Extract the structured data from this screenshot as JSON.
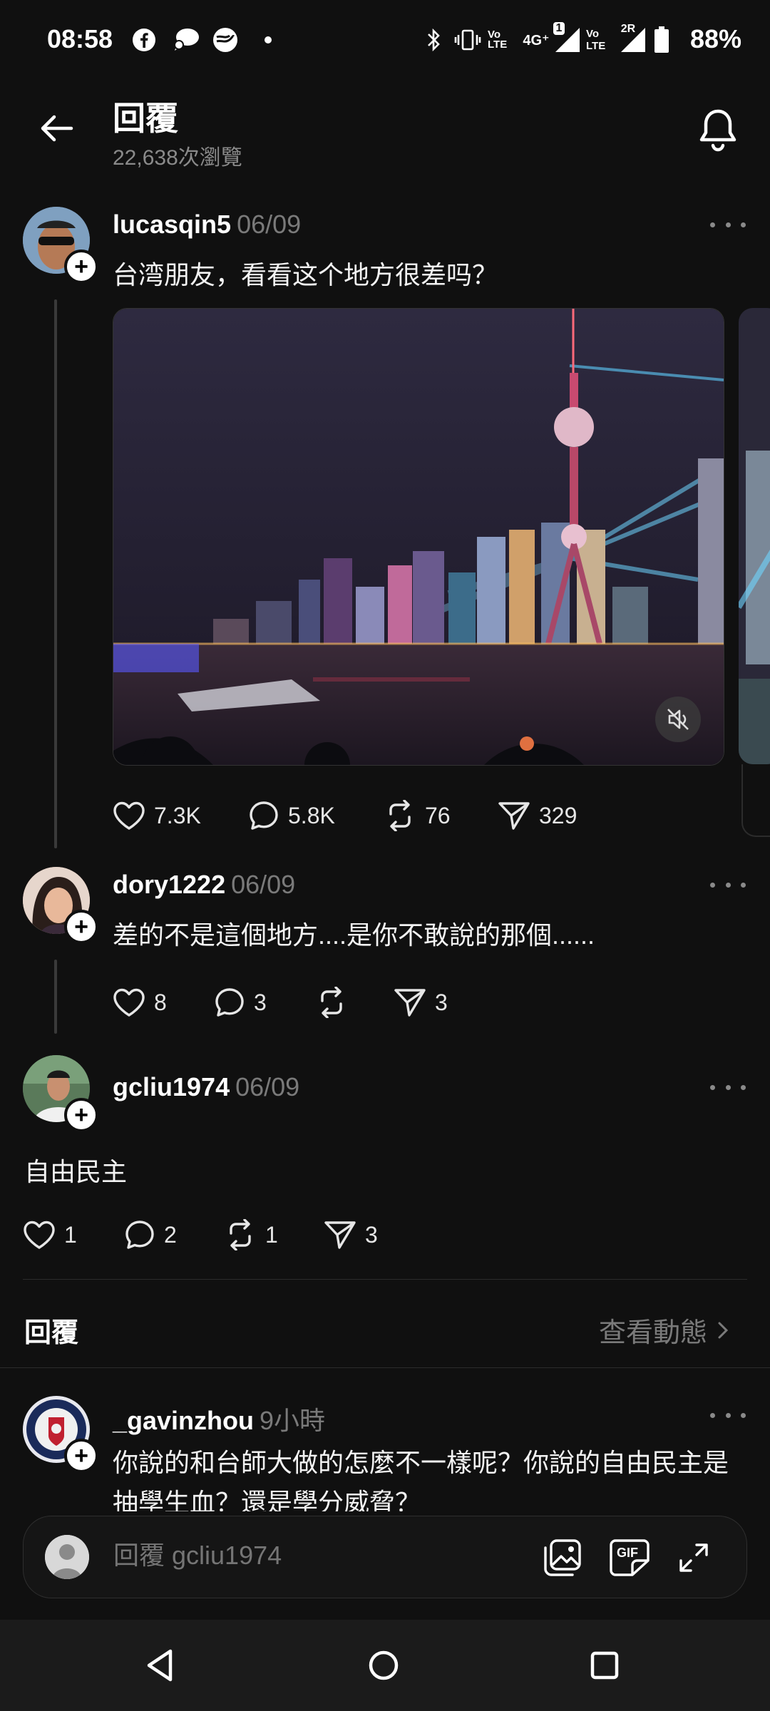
{
  "status_bar": {
    "time": "08:58",
    "battery": "88%",
    "icons": [
      "facebook-icon",
      "chat-bubble-icon",
      "threads-app-icon",
      "dot-icon",
      "bluetooth-icon",
      "vibrate-icon",
      "volte-icon",
      "4g-icon",
      "signal-icon",
      "volte-icon",
      "signal-icon",
      "battery-icon"
    ],
    "badge_1": "1",
    "badge_4g": "4G⁺",
    "badge_2r": "2R",
    "volte": "Vo LTE"
  },
  "header": {
    "title": "回覆",
    "views": "22,638次瀏覽"
  },
  "posts": [
    {
      "username": "lucasqin5",
      "date": "06/09",
      "text": "台湾朋友，看看这个地方很差吗？",
      "likes": "7.3K",
      "comments": "5.8K",
      "reposts": "76",
      "shares": "329"
    },
    {
      "username": "dory1222",
      "date": "06/09",
      "text": "差的不是這個地方....是你不敢說的那個......",
      "likes": "8",
      "comments": "3",
      "reposts": "",
      "shares": "3"
    },
    {
      "username": "gcliu1974",
      "date": "06/09",
      "text": "自由民主",
      "likes": "1",
      "comments": "2",
      "reposts": "1",
      "shares": "3"
    }
  ],
  "replies_section": {
    "label": "回覆",
    "view_activity": "查看動態"
  },
  "reply": {
    "username": "_gavinzhou",
    "date": "9小時",
    "text": "你說的和台師大做的怎麼不一樣呢？你說的自由民主是抽學生血？還是學分威脅？"
  },
  "composer": {
    "placeholder": "回覆 gcliu1974",
    "gif_label": "GIF"
  },
  "colors": {
    "background": "#101010",
    "muted_text": "#7a7a7a",
    "thread_line": "#3a3a3a"
  }
}
